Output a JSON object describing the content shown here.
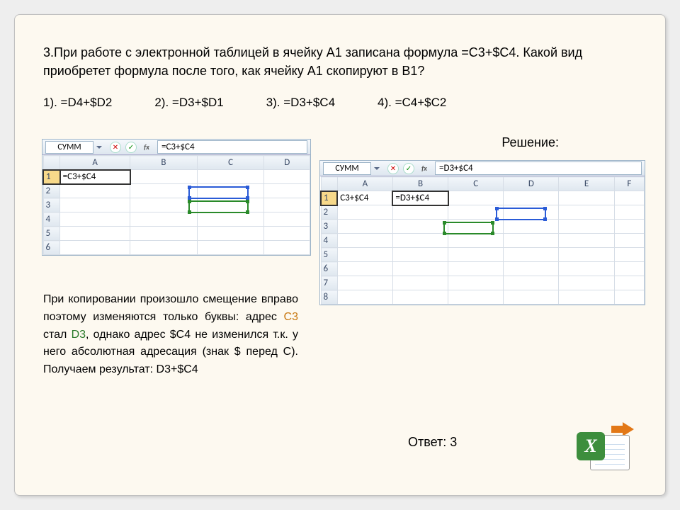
{
  "question": "3.При работе с электронной таблицей в ячейку А1 записана формула =С3+$С4. Какой вид приобретет формула после того, как ячейку А1 скопируют в В1?",
  "options": {
    "o1": "1). =D4+$D2",
    "o2": "2). =D3+$D1",
    "o3": "3). =D3+$C4",
    "o4": "4). =C4+$C2"
  },
  "solution_label": "Решение:",
  "excel1": {
    "namebox": "СУММ",
    "formula": "=C3+$C4",
    "cols": [
      "A",
      "B",
      "C",
      "D"
    ],
    "rows": [
      "1",
      "2",
      "3",
      "4",
      "5",
      "6"
    ],
    "cellA1": "=C3+$C4"
  },
  "excel2": {
    "namebox": "СУММ",
    "formula": "=D3+$C4",
    "cols": [
      "A",
      "B",
      "C",
      "D",
      "E",
      "F"
    ],
    "rows": [
      "1",
      "2",
      "3",
      "4",
      "5",
      "6",
      "7",
      "8"
    ],
    "cellA1": "C3+$C4",
    "cellB1": "=D3+$C4"
  },
  "explain": {
    "p1": "При копировании произошло смещение вправо поэтому изменяются только буквы: адрес ",
    "c3": "C3",
    "p2": " стал ",
    "d3": "D3",
    "p3": ", однако адрес $C4 не изменился т.к. у него абсолютная адресация (знак $ перед C). Получаем результат: D3+$C4"
  },
  "answer": "Ответ: 3",
  "icons": {
    "dropdown": "dropdown-icon",
    "cancel": "✕",
    "ok": "✓",
    "fx": "fx",
    "excel_x": "X"
  }
}
